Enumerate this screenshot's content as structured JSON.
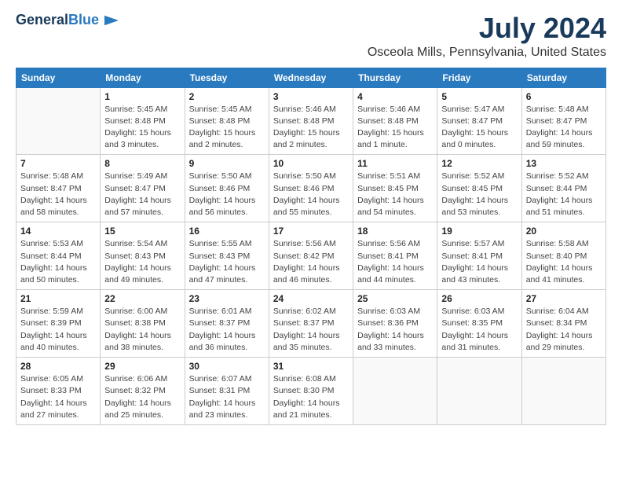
{
  "header": {
    "logo_line1": "General",
    "logo_line2": "Blue",
    "title": "July 2024",
    "subtitle": "Osceola Mills, Pennsylvania, United States"
  },
  "columns": [
    "Sunday",
    "Monday",
    "Tuesday",
    "Wednesday",
    "Thursday",
    "Friday",
    "Saturday"
  ],
  "weeks": [
    [
      {
        "day": "",
        "info": ""
      },
      {
        "day": "1",
        "info": "Sunrise: 5:45 AM\nSunset: 8:48 PM\nDaylight: 15 hours\nand 3 minutes."
      },
      {
        "day": "2",
        "info": "Sunrise: 5:45 AM\nSunset: 8:48 PM\nDaylight: 15 hours\nand 2 minutes."
      },
      {
        "day": "3",
        "info": "Sunrise: 5:46 AM\nSunset: 8:48 PM\nDaylight: 15 hours\nand 2 minutes."
      },
      {
        "day": "4",
        "info": "Sunrise: 5:46 AM\nSunset: 8:48 PM\nDaylight: 15 hours\nand 1 minute."
      },
      {
        "day": "5",
        "info": "Sunrise: 5:47 AM\nSunset: 8:47 PM\nDaylight: 15 hours\nand 0 minutes."
      },
      {
        "day": "6",
        "info": "Sunrise: 5:48 AM\nSunset: 8:47 PM\nDaylight: 14 hours\nand 59 minutes."
      }
    ],
    [
      {
        "day": "7",
        "info": "Sunrise: 5:48 AM\nSunset: 8:47 PM\nDaylight: 14 hours\nand 58 minutes."
      },
      {
        "day": "8",
        "info": "Sunrise: 5:49 AM\nSunset: 8:47 PM\nDaylight: 14 hours\nand 57 minutes."
      },
      {
        "day": "9",
        "info": "Sunrise: 5:50 AM\nSunset: 8:46 PM\nDaylight: 14 hours\nand 56 minutes."
      },
      {
        "day": "10",
        "info": "Sunrise: 5:50 AM\nSunset: 8:46 PM\nDaylight: 14 hours\nand 55 minutes."
      },
      {
        "day": "11",
        "info": "Sunrise: 5:51 AM\nSunset: 8:45 PM\nDaylight: 14 hours\nand 54 minutes."
      },
      {
        "day": "12",
        "info": "Sunrise: 5:52 AM\nSunset: 8:45 PM\nDaylight: 14 hours\nand 53 minutes."
      },
      {
        "day": "13",
        "info": "Sunrise: 5:52 AM\nSunset: 8:44 PM\nDaylight: 14 hours\nand 51 minutes."
      }
    ],
    [
      {
        "day": "14",
        "info": "Sunrise: 5:53 AM\nSunset: 8:44 PM\nDaylight: 14 hours\nand 50 minutes."
      },
      {
        "day": "15",
        "info": "Sunrise: 5:54 AM\nSunset: 8:43 PM\nDaylight: 14 hours\nand 49 minutes."
      },
      {
        "day": "16",
        "info": "Sunrise: 5:55 AM\nSunset: 8:43 PM\nDaylight: 14 hours\nand 47 minutes."
      },
      {
        "day": "17",
        "info": "Sunrise: 5:56 AM\nSunset: 8:42 PM\nDaylight: 14 hours\nand 46 minutes."
      },
      {
        "day": "18",
        "info": "Sunrise: 5:56 AM\nSunset: 8:41 PM\nDaylight: 14 hours\nand 44 minutes."
      },
      {
        "day": "19",
        "info": "Sunrise: 5:57 AM\nSunset: 8:41 PM\nDaylight: 14 hours\nand 43 minutes."
      },
      {
        "day": "20",
        "info": "Sunrise: 5:58 AM\nSunset: 8:40 PM\nDaylight: 14 hours\nand 41 minutes."
      }
    ],
    [
      {
        "day": "21",
        "info": "Sunrise: 5:59 AM\nSunset: 8:39 PM\nDaylight: 14 hours\nand 40 minutes."
      },
      {
        "day": "22",
        "info": "Sunrise: 6:00 AM\nSunset: 8:38 PM\nDaylight: 14 hours\nand 38 minutes."
      },
      {
        "day": "23",
        "info": "Sunrise: 6:01 AM\nSunset: 8:37 PM\nDaylight: 14 hours\nand 36 minutes."
      },
      {
        "day": "24",
        "info": "Sunrise: 6:02 AM\nSunset: 8:37 PM\nDaylight: 14 hours\nand 35 minutes."
      },
      {
        "day": "25",
        "info": "Sunrise: 6:03 AM\nSunset: 8:36 PM\nDaylight: 14 hours\nand 33 minutes."
      },
      {
        "day": "26",
        "info": "Sunrise: 6:03 AM\nSunset: 8:35 PM\nDaylight: 14 hours\nand 31 minutes."
      },
      {
        "day": "27",
        "info": "Sunrise: 6:04 AM\nSunset: 8:34 PM\nDaylight: 14 hours\nand 29 minutes."
      }
    ],
    [
      {
        "day": "28",
        "info": "Sunrise: 6:05 AM\nSunset: 8:33 PM\nDaylight: 14 hours\nand 27 minutes."
      },
      {
        "day": "29",
        "info": "Sunrise: 6:06 AM\nSunset: 8:32 PM\nDaylight: 14 hours\nand 25 minutes."
      },
      {
        "day": "30",
        "info": "Sunrise: 6:07 AM\nSunset: 8:31 PM\nDaylight: 14 hours\nand 23 minutes."
      },
      {
        "day": "31",
        "info": "Sunrise: 6:08 AM\nSunset: 8:30 PM\nDaylight: 14 hours\nand 21 minutes."
      },
      {
        "day": "",
        "info": ""
      },
      {
        "day": "",
        "info": ""
      },
      {
        "day": "",
        "info": ""
      }
    ]
  ]
}
